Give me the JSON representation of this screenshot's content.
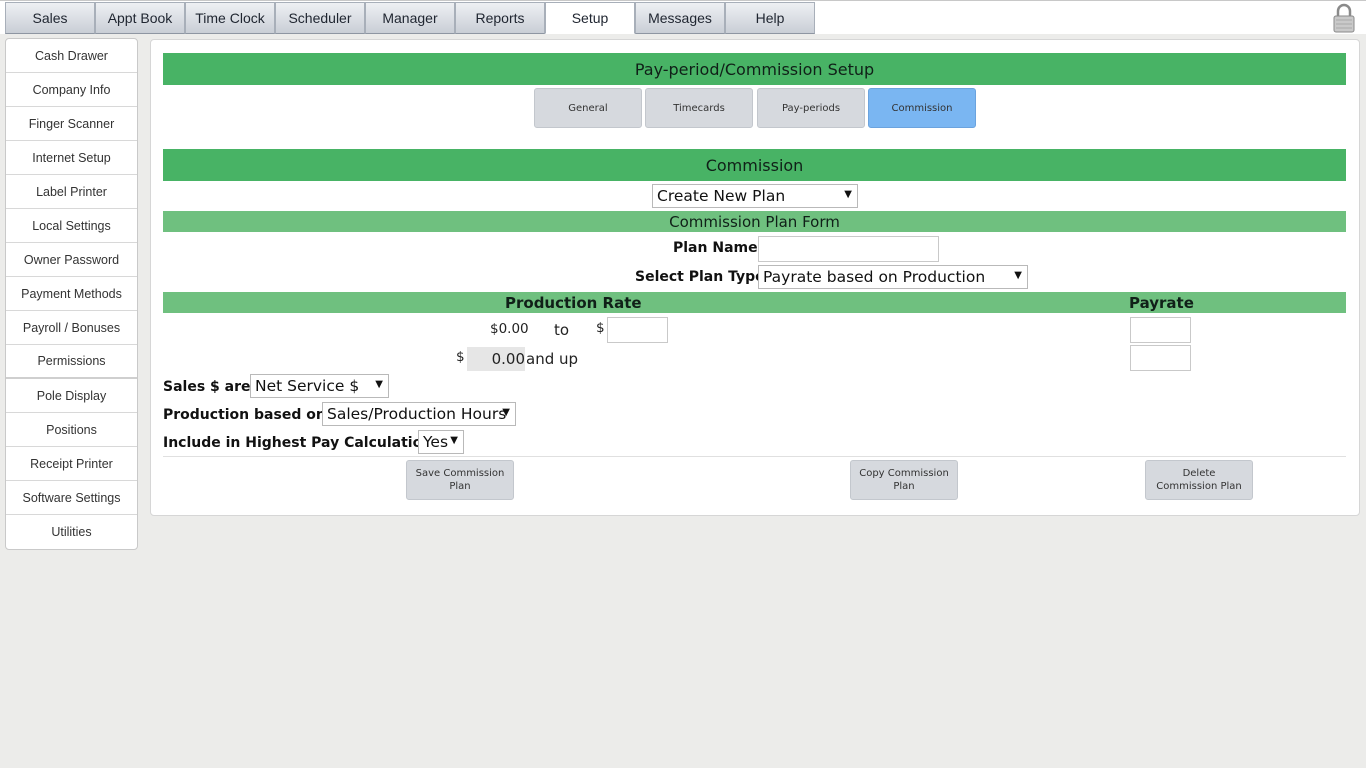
{
  "top_tabs": [
    {
      "label": "Sales"
    },
    {
      "label": "Appt Book"
    },
    {
      "label": "Time Clock"
    },
    {
      "label": "Scheduler"
    },
    {
      "label": "Manager"
    },
    {
      "label": "Reports"
    },
    {
      "label": "Setup",
      "active": true
    },
    {
      "label": "Messages"
    },
    {
      "label": "Help"
    }
  ],
  "sidebar": {
    "items": [
      {
        "label": "Cash Drawer"
      },
      {
        "label": "Company Info"
      },
      {
        "label": "Finger Scanner"
      },
      {
        "label": "Internet Setup"
      },
      {
        "label": "Label Printer"
      },
      {
        "label": "Local Settings"
      },
      {
        "label": "Owner Password"
      },
      {
        "label": "Payment Methods"
      },
      {
        "label": "Payroll / Bonuses"
      },
      {
        "label": "Permissions"
      },
      {
        "label": "Pole Display"
      },
      {
        "label": "Positions"
      },
      {
        "label": "Receipt Printer"
      },
      {
        "label": "Software Settings"
      },
      {
        "label": "Utilities"
      }
    ]
  },
  "main": {
    "title": "Pay-period/Commission Setup",
    "subtabs": [
      {
        "label": "General"
      },
      {
        "label": "Timecards"
      },
      {
        "label": "Pay-periods"
      },
      {
        "label": "Commission",
        "active": true
      }
    ],
    "section_title": "Commission",
    "plan_select": {
      "value": "Create New Plan"
    },
    "form_title": "Commission Plan Form",
    "plan_name": {
      "label": "Plan Name:",
      "value": ""
    },
    "plan_type": {
      "label": "Select Plan Type:",
      "value": "Payrate based on Production"
    },
    "table": {
      "headers": {
        "production_rate": "Production Rate",
        "payrate": "Payrate"
      },
      "row1": {
        "from": "$0.00",
        "to_label": "to",
        "currency": "$",
        "to_value": "",
        "payrate": ""
      },
      "row2": {
        "currency": "$",
        "from_value": "0.00",
        "and_up": "and up",
        "payrate": ""
      }
    },
    "sales_are": {
      "label": "Sales $ are:",
      "value": "Net Service $"
    },
    "production_based_on": {
      "label": "Production based on:",
      "value": "Sales/Production Hours"
    },
    "highest_pay": {
      "label": "Include in Highest Pay Calculation:",
      "value": "Yes"
    },
    "buttons": {
      "save": "Save Commission Plan",
      "copy": "Copy Commission Plan",
      "delete": "Delete Commission Plan"
    }
  },
  "colors": {
    "header_green": "#48b365",
    "light_green": "#6fc07f",
    "active_tab_blue": "#7ab6f2"
  }
}
